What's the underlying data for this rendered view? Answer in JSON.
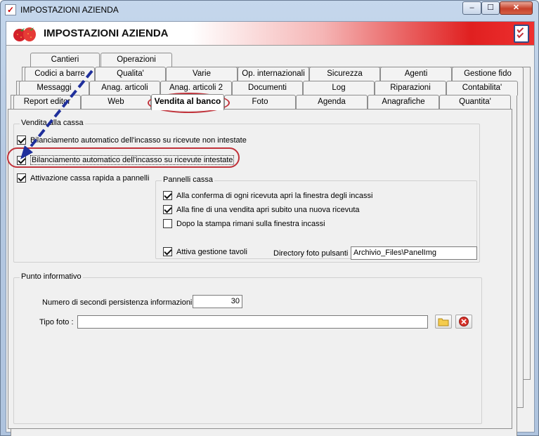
{
  "window": {
    "title": "IMPOSTAZIONI AZIENDA",
    "controls": {
      "minimize": "–",
      "maximize": "☐",
      "close": "✕"
    }
  },
  "header": {
    "title": "IMPOSTAZIONI AZIENDA"
  },
  "tabs": {
    "row1": [
      "Cantieri",
      "Operazioni"
    ],
    "row2": [
      "Codici a barre",
      "Qualita'",
      "Varie",
      "Op. internazionali",
      "Sicurezza",
      "Agenti",
      "Gestione fido"
    ],
    "row3": [
      "Messaggi",
      "Anag. articoli",
      "Anag. articoli 2",
      "Documenti",
      "Log",
      "Riparazioni",
      "Contabilita'"
    ],
    "row4": [
      "Report editor",
      "Web",
      "Vendita al banco",
      "Foto",
      "Agenda",
      "Anagrafiche",
      "Quantita'"
    ],
    "active": "Vendita al banco"
  },
  "vendita_cassa": {
    "title": "Vendita alla cassa",
    "opt1": {
      "label": "Bilanciamento automatico dell'incasso su ricevute non intestate",
      "checked": true
    },
    "opt2": {
      "label": "Bilanciamento automatico dell'incasso su ricevute intestate",
      "checked": true
    },
    "opt3": {
      "label": "Attivazione cassa rapida a pannelli",
      "checked": true
    }
  },
  "pannelli_cassa": {
    "title": "Pannelli cassa",
    "opt1": {
      "label": "Alla conferma di ogni ricevuta apri la finestra degli incassi",
      "checked": true
    },
    "opt2": {
      "label": "Alla fine di una vendita apri subito una nuova ricevuta",
      "checked": true
    },
    "opt3": {
      "label": "Dopo la stampa rimani sulla finestra incassi",
      "checked": false
    },
    "opt4": {
      "label": "Attiva gestione tavoli",
      "checked": true
    },
    "directory_label": "Directory foto pulsanti :",
    "directory_value": "Archivio_Files\\PanelImg"
  },
  "punto_informativo": {
    "title": "Punto informativo",
    "seconds_label": "Numero di secondi persistenza informazioni :",
    "seconds_value": "30",
    "photo_label": "Tipo foto :",
    "photo_value": ""
  },
  "colors": {
    "annotation": "#c0323a",
    "arrow": "#1f2f9c",
    "header_red": "#e02020"
  }
}
